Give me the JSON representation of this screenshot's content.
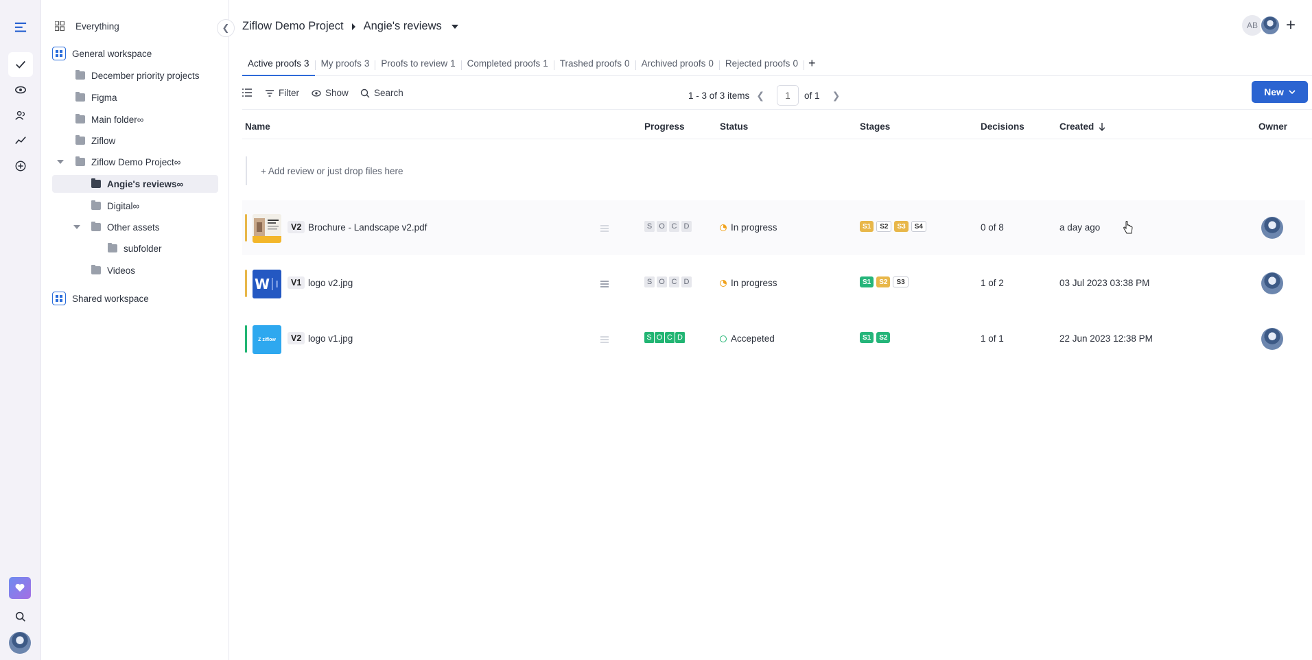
{
  "sidebar": {
    "everything": "Everything",
    "general_workspace": "General workspace",
    "items": [
      {
        "label": "December priority projects"
      },
      {
        "label": "Figma"
      },
      {
        "label": "Main folder∞"
      },
      {
        "label": "Ziflow"
      },
      {
        "label": "Ziflow Demo Project∞"
      },
      {
        "label": "Angie's reviews∞"
      },
      {
        "label": "Digital∞"
      },
      {
        "label": "Other assets"
      },
      {
        "label": "subfolder"
      },
      {
        "label": "Videos"
      }
    ],
    "shared_workspace": "Shared workspace"
  },
  "header": {
    "project": "Ziflow Demo Project",
    "page": "Angie's reviews",
    "initials": "AB"
  },
  "tabs": [
    {
      "label": "Active proofs",
      "count": "3"
    },
    {
      "label": "My proofs",
      "count": "3"
    },
    {
      "label": "Proofs to review",
      "count": "1"
    },
    {
      "label": "Completed proofs",
      "count": "1"
    },
    {
      "label": "Trashed proofs",
      "count": "0"
    },
    {
      "label": "Archived proofs",
      "count": "0"
    },
    {
      "label": "Rejected proofs",
      "count": "0"
    }
  ],
  "toolbar": {
    "filter": "Filter",
    "show": "Show",
    "search": "Search",
    "range": "1 - 3 of 3 items",
    "page": "1",
    "of": "of 1",
    "new": "New"
  },
  "columns": {
    "name": "Name",
    "progress": "Progress",
    "status": "Status",
    "stages": "Stages",
    "decisions": "Decisions",
    "created": "Created",
    "owner": "Owner"
  },
  "add_review": "+ Add review or just drop files here",
  "rows": [
    {
      "version": "V2",
      "name": "Brochure - Landscape v2.pdf",
      "progress": [
        "S",
        "O",
        "C",
        "D"
      ],
      "status": "In progress",
      "stages": [
        "S1",
        "S2",
        "S3",
        "S4"
      ],
      "decisions": "0 of 8",
      "created": "a day ago",
      "bar_color": "#e8b74a"
    },
    {
      "version": "V1",
      "name": "logo v2.jpg",
      "progress": [
        "S",
        "O",
        "C",
        "D"
      ],
      "status": "In progress",
      "stages": [
        "S1",
        "S2",
        "S3"
      ],
      "decisions": "1 of 2",
      "created": "03 Jul 2023 03:38 PM",
      "bar_color": "#e8b74a"
    },
    {
      "version": "V2",
      "name": "logo v1.jpg",
      "progress": [
        "S",
        "O",
        "C",
        "D"
      ],
      "status": "Accepeted",
      "stages": [
        "S1",
        "S2"
      ],
      "decisions": "1 of 1",
      "created": "22 Jun 2023 12:38 PM",
      "bar_color": "#22b573",
      "thumb_text": "Z ziflow"
    }
  ],
  "colors": {
    "accent": "#2b64d1",
    "in_progress": "#f0a21c",
    "accepted": "#22b573",
    "stage_yellow": "#e8b74a",
    "stage_green": "#25b57a"
  }
}
